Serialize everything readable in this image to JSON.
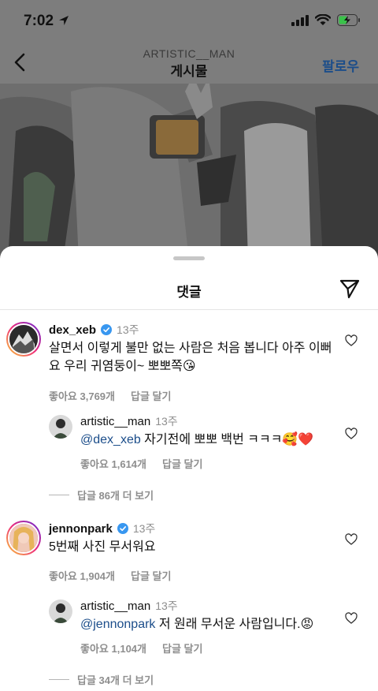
{
  "status_bar": {
    "time": "7:02"
  },
  "header": {
    "username": "ARTISTIC__MAN",
    "title": "게시물",
    "follow_label": "팔로우"
  },
  "sheet": {
    "title": "댓글"
  },
  "comments": [
    {
      "username": "dex_xeb",
      "verified": true,
      "time": "13주",
      "text_line1": "살면서 이렇게 불만 없는 사람은 처음 봅니다 아주 이뻐",
      "text_line2": "요 우리 귀염둥이~ 뽀뽀쪽😘",
      "likes": "좋아요 3,769개",
      "reply_label": "답글 달기",
      "reply": {
        "username": "artistic__man",
        "time": "13주",
        "mention": "@dex_xeb",
        "text": " 자기전에 뽀뽀 백번 ㅋㅋㅋ🥰❤️",
        "likes": "좋아요 1,614개",
        "reply_label": "답글 달기"
      },
      "more_replies": "답글 86개 더 보기"
    },
    {
      "username": "jennonpark",
      "verified": true,
      "time": "13주",
      "text_line1": "5번째 사진 무서워요",
      "likes": "좋아요 1,904개",
      "reply_label": "답글 달기",
      "reply": {
        "username": "artistic__man",
        "time": "13주",
        "mention": "@jennonpark",
        "text": " 저 원래 무서운 사람입니다.😡",
        "likes": "좋아요 1,104개",
        "reply_label": "답글 달기"
      },
      "more_replies": "답글 34개 더 보기"
    }
  ],
  "colors": {
    "link_blue": "#1b4d8a",
    "muted_gray": "#8e8e8e",
    "verified_blue": "#3897f0"
  }
}
